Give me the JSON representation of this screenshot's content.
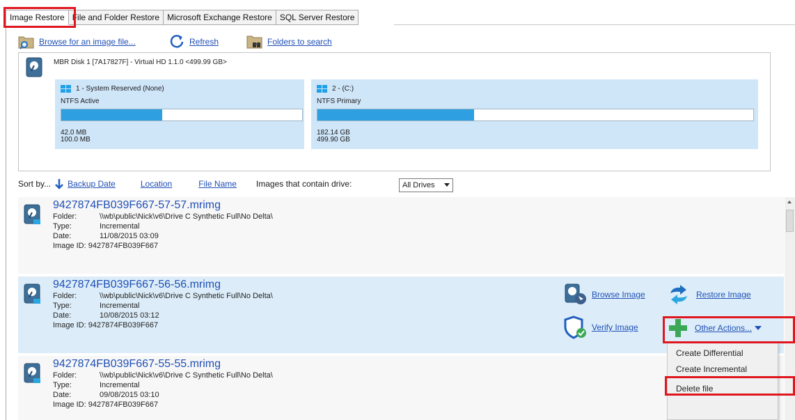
{
  "tabs": [
    {
      "label": "Image Restore",
      "active": true
    },
    {
      "label": "File and Folder Restore"
    },
    {
      "label": "Microsoft Exchange Restore"
    },
    {
      "label": "SQL Server Restore"
    }
  ],
  "toolbar": {
    "browse_label": "Browse for an image file...",
    "refresh_label": "Refresh",
    "folders_label": "Folders to search"
  },
  "disk": {
    "title": "MBR Disk 1 [7A17827F] - Virtual HD 1.1.0  <499.99 GB>",
    "partitions": [
      {
        "name": "1 - System Reserved (None)",
        "fs": "NTFS Active",
        "used": "42.0 MB",
        "total": "100.0 MB",
        "fill_percent": 42
      },
      {
        "name": "2 - (C:)",
        "fs": "NTFS Primary",
        "used": "182.14 GB",
        "total": "499.90 GB",
        "fill_percent": 36
      }
    ]
  },
  "sort": {
    "label": "Sort by...",
    "backup_date": "Backup Date",
    "location": "Location",
    "file_name": "File Name",
    "drive_filter_label": "Images that contain drive:",
    "drive_filter_value": "All Drives"
  },
  "meta_keys": {
    "folder": "Folder:",
    "type": "Type:",
    "date": "Date:",
    "image_id": "Image ID:"
  },
  "images": [
    {
      "name": "9427874FB039F667-57-57.mrimg",
      "folder": "\\\\wb\\public\\Nick\\v6\\Drive C Synthetic Full\\No Delta\\",
      "type": "Incremental",
      "date": "11/08/2015 03:09",
      "image_id": "9427874FB039F667"
    },
    {
      "name": "9427874FB039F667-56-56.mrimg",
      "folder": "\\\\wb\\public\\Nick\\v6\\Drive C Synthetic Full\\No Delta\\",
      "type": "Incremental",
      "date": "10/08/2015 03:12",
      "image_id": "9427874FB039F667"
    },
    {
      "name": "9427874FB039F667-55-55.mrimg",
      "folder": "\\\\wb\\public\\Nick\\v6\\Drive C Synthetic Full\\No Delta\\",
      "type": "Incremental",
      "date": "09/08/2015 03:10",
      "image_id": "9427874FB039F667"
    }
  ],
  "actions": {
    "browse_image": "Browse Image",
    "restore_image": "Restore Image",
    "verify_image": "Verify Image",
    "other_actions": "Other Actions..."
  },
  "other_actions_menu": [
    "Create Differential",
    "Create Incremental",
    "Delete file"
  ],
  "colors": {
    "highlight": "#e0161f",
    "link": "#1f4fb5",
    "selected_row": "#dcedf9",
    "partition_bg": "#cfe5f8",
    "usage_bar": "#2e9fe0"
  }
}
